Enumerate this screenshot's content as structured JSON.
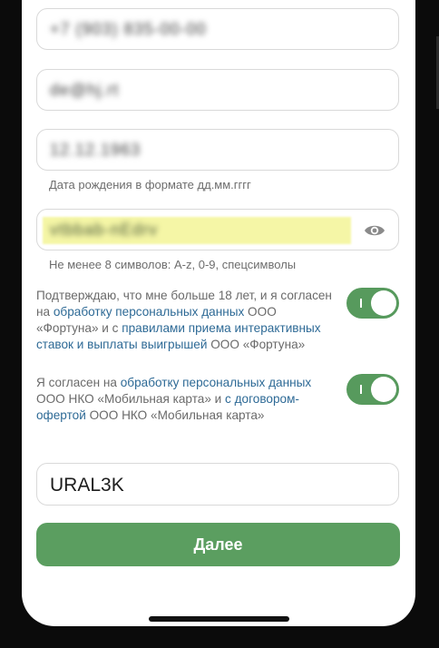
{
  "form": {
    "phone": {
      "value": "+7 (903) 835-00-00"
    },
    "email": {
      "value": "de@hj.rt"
    },
    "birthdate": {
      "value": "12.12.1963",
      "hint": "Дата рождения в формате дд.мм.гггг"
    },
    "password": {
      "value": "vtbbab-nEdrv",
      "hint": "Не менее 8 символов: A-z, 0-9, спецсимволы"
    },
    "consent1": {
      "t1": "Подтверждаю, что мне больше 18 лет, и я согласен на ",
      "l1": "обработку персональных данных",
      "t2": " ООО «Фортуна» и с ",
      "l2": "правилами приема интерактивных ставок и выплаты выигрышей",
      "t3": " ООО «Фортуна»",
      "checked": true
    },
    "consent2": {
      "t1": "Я согласен на ",
      "l1": "обработку персональных данных",
      "t2": " ООО НКО «Мобильная карта» и ",
      "l2": "с договором-офертой",
      "t3": " ООО НКО «Мобильная карта»",
      "checked": true
    },
    "promo": {
      "value": "URAL3K"
    },
    "submit_label": "Далее"
  },
  "colors": {
    "accent": "#5b9e60",
    "link": "#2e6a96"
  },
  "icons": {
    "password_toggle": "eye-icon"
  }
}
